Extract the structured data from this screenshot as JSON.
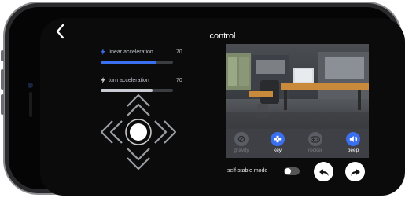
{
  "header": {
    "title": "control"
  },
  "controls": {
    "linear": {
      "label": "linear acceleration",
      "value": "70",
      "level": 0.77
    },
    "turn": {
      "label": "turn acceleration",
      "value": "70",
      "level": 0.72
    }
  },
  "tools": [
    {
      "label": "gravity",
      "icon": "gravity-icon",
      "active": false
    },
    {
      "label": "key",
      "icon": "key-icon",
      "active": true
    },
    {
      "label": "rocker",
      "icon": "gamepad-icon",
      "active": false
    },
    {
      "label": "beep",
      "icon": "speaker-icon",
      "active": true
    }
  ],
  "bottom": {
    "mode_label": "self-stable mode",
    "mode_on": false
  },
  "colors": {
    "accent": "#3a6ff0",
    "active_tool_bg": "#3a6ff0",
    "inactive_tool_bg": "#5a5d64",
    "inactive_label": "#7a7d84",
    "active_label": "#ffffff",
    "linear_fill": "#3a6ff0",
    "turn_fill": "#c8ccd2"
  }
}
